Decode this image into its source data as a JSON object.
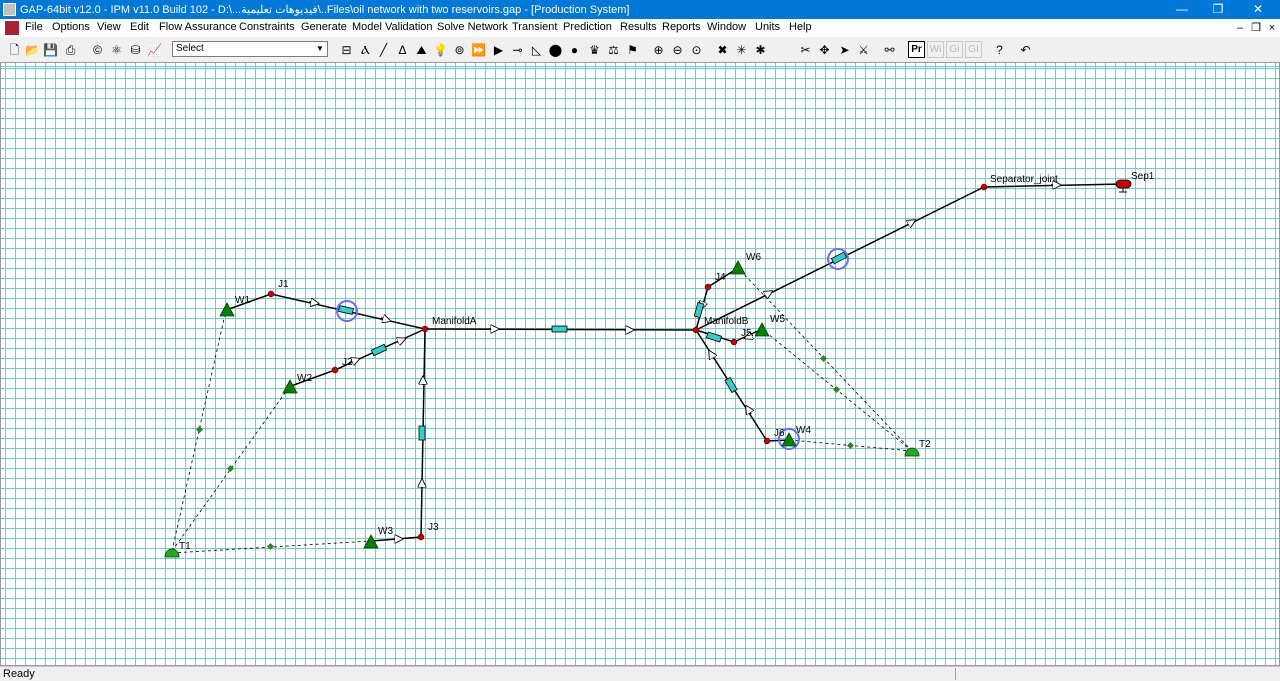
{
  "window": {
    "title": "GAP-64bit v12.0 - IPM v11.0 Build 102 - D:\\...فيديوهات تعليمية\\..Files\\oil network with two reservoirs.gap - [Production System]",
    "minimize": "—",
    "restore": "❐",
    "close": "✕"
  },
  "menu": {
    "items": [
      "File",
      "Options",
      "View",
      "Edit",
      "Flow Assurance",
      "Constraints",
      "Generate",
      "Model Validation",
      "Solve Network",
      "Transient",
      "Prediction",
      "Results",
      "Reports",
      "Window",
      "Units",
      "Help"
    ],
    "child_minimize": "–",
    "child_restore": "❐",
    "child_close": "×"
  },
  "toolbar": {
    "select_value": "Select",
    "select_arrow": "▼",
    "pr_label": "Pr",
    "wi_label": "Wi",
    "gi_label": "Gi",
    "gi2_label": "GI",
    "icons": [
      "new-icon",
      "open-icon",
      "save-icon",
      "print-icon",
      "copyright-icon",
      "network-icon",
      "tank-icon",
      "chart-icon",
      "separator-icon",
      "well-icon",
      "pipe-icon",
      "joint-icon",
      "inline-icon",
      "valve-icon",
      "compressor-icon",
      "pump-icon",
      "play-icon",
      "choke-icon",
      "triangle-icon",
      "colors-icon",
      "node-icon",
      "crown-icon",
      "bag-icon",
      "group-icon",
      "zoom-in-icon",
      "zoom-out-icon",
      "zoom-fit-icon",
      "delete-icon",
      "star-icon",
      "cross-icon",
      "blank-icon",
      "cut-icon",
      "move-icon",
      "pointer-icon",
      "unlink-icon",
      "binoculars-icon",
      "help-icon",
      "undo-icon"
    ]
  },
  "network": {
    "labels": {
      "W1": "W1",
      "W2": "W2",
      "W3": "W3",
      "W4": "W4",
      "W5": "W5",
      "W6": "W6",
      "J1": "J1",
      "J2": "J2",
      "J3": "J3",
      "J4": "J4",
      "J5": "J5",
      "J6": "J6",
      "T1": "T1",
      "T2": "T2",
      "ManifoldA": "ManifoldA",
      "ManifoldB": "ManifoldB",
      "Separator_joint": "Separator_joint",
      "Sep1": "Sep1"
    }
  },
  "status": {
    "text": "Ready"
  },
  "colors": {
    "titlebar": "#0078d7",
    "grid": "#5cd6d6",
    "well": "#008000",
    "joint": "#cc0000",
    "pipe_equipment": "#33cccc",
    "selection_circle": "#6a6aff"
  }
}
